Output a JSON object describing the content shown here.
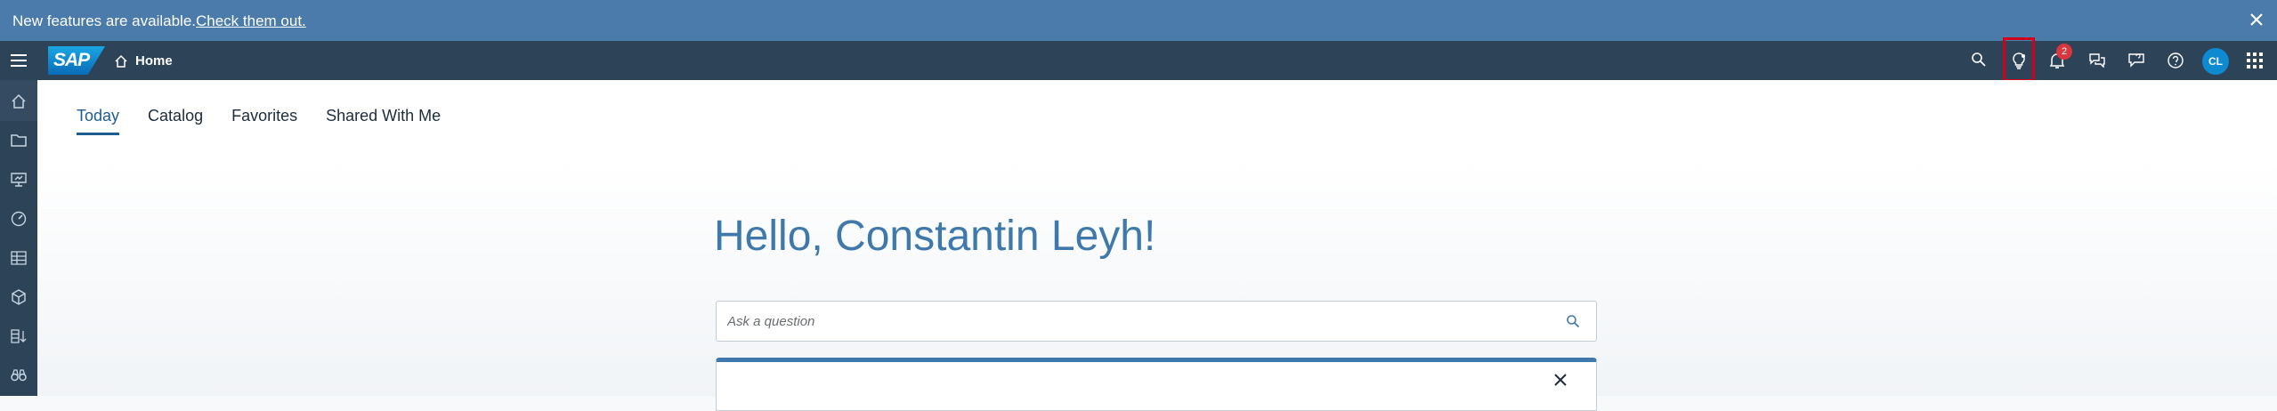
{
  "banner": {
    "message": "New features are available.",
    "link_text": "Check them out."
  },
  "shellbar": {
    "logo_text": "SAP",
    "home_label": "Home",
    "notification_count": "2",
    "avatar_initials": "CL",
    "icons": [
      "search-icon",
      "lightbulb-icon",
      "bell-icon",
      "chat-icon",
      "feedback-icon",
      "help-icon",
      "product-switch-icon"
    ]
  },
  "sidebar": {
    "icons": [
      "home-icon",
      "folder-icon",
      "presentation-icon",
      "gauge-icon",
      "grid-table-icon",
      "cube-icon",
      "list-sort-icon",
      "binoculars-icon"
    ]
  },
  "tabs": [
    {
      "label": "Today",
      "active": true
    },
    {
      "label": "Catalog",
      "active": false
    },
    {
      "label": "Favorites",
      "active": false
    },
    {
      "label": "Shared With Me",
      "active": false
    }
  ],
  "greeting": "Hello, Constantin Leyh!",
  "search": {
    "placeholder": "Ask a question",
    "value": ""
  },
  "colors": {
    "banner": "#4a7bab",
    "shellbar": "#2d4358",
    "accent": "#3f79ab",
    "badge": "#d9363e",
    "highlight": "#d0021b"
  }
}
